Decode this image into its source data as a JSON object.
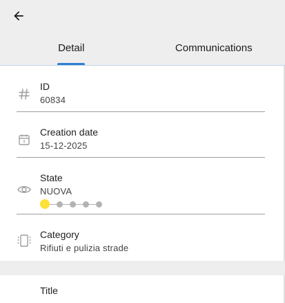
{
  "header": {
    "back_icon": "arrow-left-icon"
  },
  "tabs": [
    {
      "label": "Detail",
      "active": true
    },
    {
      "label": "Communications",
      "active": false
    }
  ],
  "fields": {
    "id": {
      "label": "ID",
      "value": "60834",
      "icon": "hash-icon"
    },
    "creation_date": {
      "label": "Creation date",
      "value": "15-12-2025",
      "icon": "calendar-icon"
    },
    "state": {
      "label": "State",
      "value": "NUOVA",
      "icon": "eye-icon",
      "steps_total": 5,
      "current_step": 1
    },
    "category": {
      "label": "Category",
      "value": "Rifiuti e pulizia strade",
      "icon": "category-icon"
    }
  },
  "next_section": {
    "label": "Title"
  },
  "colors": {
    "accent": "#2f80d1",
    "step_active": "#fde13a",
    "step_inactive": "#b3b3b3",
    "background": "#eeeeee"
  }
}
